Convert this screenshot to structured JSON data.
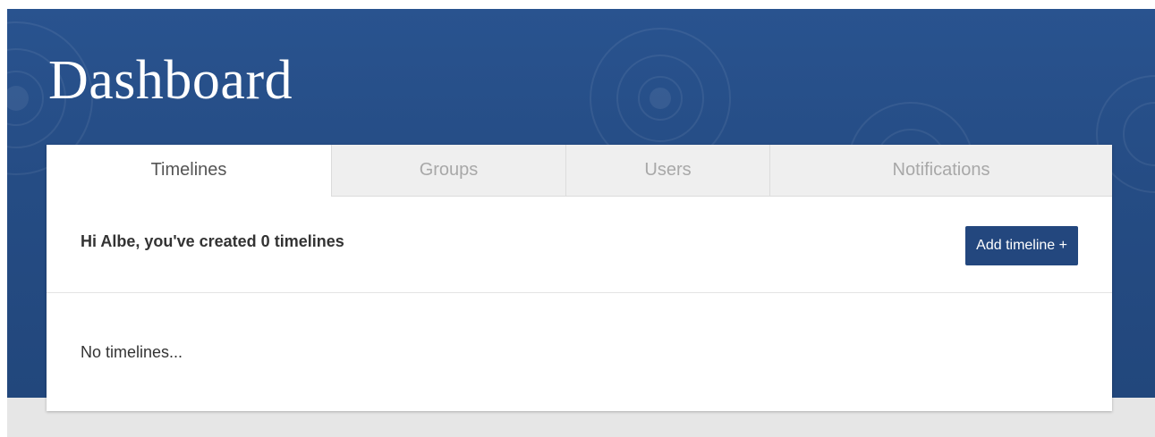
{
  "header": {
    "title": "Dashboard"
  },
  "tabs": [
    {
      "label": "Timelines",
      "active": true
    },
    {
      "label": "Groups",
      "active": false
    },
    {
      "label": "Users",
      "active": false
    },
    {
      "label": "Notifications",
      "active": false
    }
  ],
  "timelines_panel": {
    "greeting": "Hi Albe, you've created 0 timelines",
    "add_button_label": "Add timeline +",
    "empty_message": "No timelines..."
  },
  "colors": {
    "hero_background": "#254c84",
    "accent_button": "#23477e",
    "inactive_tab": "#efefef",
    "footer_band": "#e6e6e6"
  }
}
